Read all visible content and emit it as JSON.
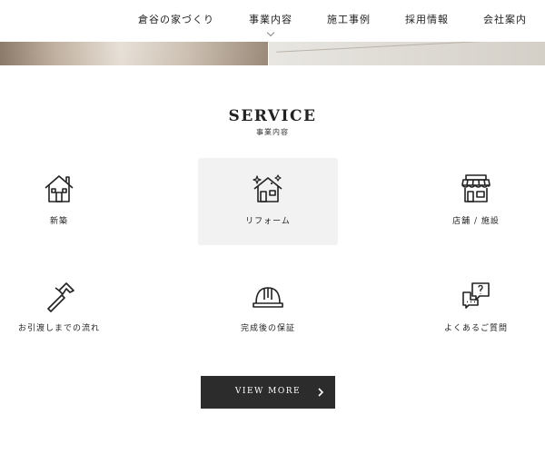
{
  "nav": {
    "items": [
      "倉谷の家づくり",
      "事業内容",
      "施工事例",
      "採用情報",
      "会社案内"
    ]
  },
  "section": {
    "title": "SERVICE",
    "subtitle": "事業内容"
  },
  "services": [
    {
      "label": "新築",
      "icon": "house-icon"
    },
    {
      "label": "リフォーム",
      "icon": "renovated-house-icon"
    },
    {
      "label": "店舗 / 施設",
      "icon": "store-icon"
    },
    {
      "label": "お引渡しまでの流れ",
      "icon": "hammer-icon"
    },
    {
      "label": "完成後の保証",
      "icon": "hard-hat-icon"
    },
    {
      "label": "よくあるご質問",
      "icon": "faq-chat-icon"
    }
  ],
  "button": {
    "label": "VIEW MORE",
    "icon": "chevron-right-icon"
  },
  "colors": {
    "button_bg": "#2c2c2c",
    "highlight_bg": "#f2f2f3",
    "text": "#222222"
  }
}
